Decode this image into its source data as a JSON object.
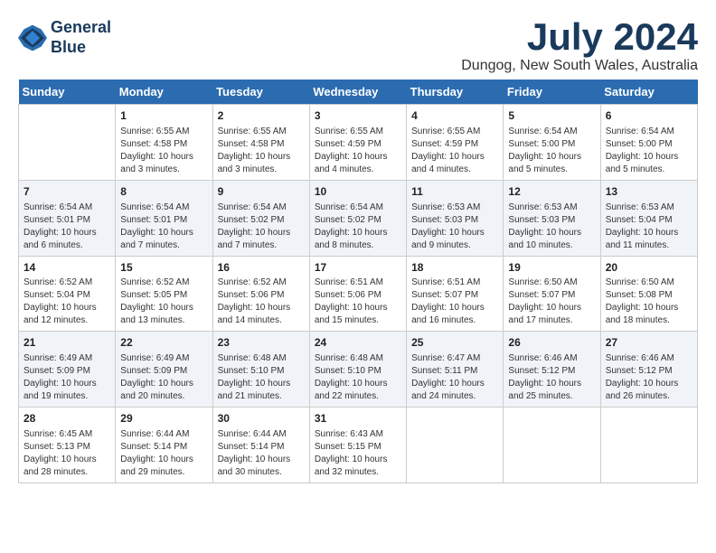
{
  "header": {
    "logo_line1": "General",
    "logo_line2": "Blue",
    "month": "July 2024",
    "location": "Dungog, New South Wales, Australia"
  },
  "days_of_week": [
    "Sunday",
    "Monday",
    "Tuesday",
    "Wednesday",
    "Thursday",
    "Friday",
    "Saturday"
  ],
  "weeks": [
    [
      {
        "day": "",
        "info": ""
      },
      {
        "day": "1",
        "info": "Sunrise: 6:55 AM\nSunset: 4:58 PM\nDaylight: 10 hours\nand 3 minutes."
      },
      {
        "day": "2",
        "info": "Sunrise: 6:55 AM\nSunset: 4:58 PM\nDaylight: 10 hours\nand 3 minutes."
      },
      {
        "day": "3",
        "info": "Sunrise: 6:55 AM\nSunset: 4:59 PM\nDaylight: 10 hours\nand 4 minutes."
      },
      {
        "day": "4",
        "info": "Sunrise: 6:55 AM\nSunset: 4:59 PM\nDaylight: 10 hours\nand 4 minutes."
      },
      {
        "day": "5",
        "info": "Sunrise: 6:54 AM\nSunset: 5:00 PM\nDaylight: 10 hours\nand 5 minutes."
      },
      {
        "day": "6",
        "info": "Sunrise: 6:54 AM\nSunset: 5:00 PM\nDaylight: 10 hours\nand 5 minutes."
      }
    ],
    [
      {
        "day": "7",
        "info": "Sunrise: 6:54 AM\nSunset: 5:01 PM\nDaylight: 10 hours\nand 6 minutes."
      },
      {
        "day": "8",
        "info": "Sunrise: 6:54 AM\nSunset: 5:01 PM\nDaylight: 10 hours\nand 7 minutes."
      },
      {
        "day": "9",
        "info": "Sunrise: 6:54 AM\nSunset: 5:02 PM\nDaylight: 10 hours\nand 7 minutes."
      },
      {
        "day": "10",
        "info": "Sunrise: 6:54 AM\nSunset: 5:02 PM\nDaylight: 10 hours\nand 8 minutes."
      },
      {
        "day": "11",
        "info": "Sunrise: 6:53 AM\nSunset: 5:03 PM\nDaylight: 10 hours\nand 9 minutes."
      },
      {
        "day": "12",
        "info": "Sunrise: 6:53 AM\nSunset: 5:03 PM\nDaylight: 10 hours\nand 10 minutes."
      },
      {
        "day": "13",
        "info": "Sunrise: 6:53 AM\nSunset: 5:04 PM\nDaylight: 10 hours\nand 11 minutes."
      }
    ],
    [
      {
        "day": "14",
        "info": "Sunrise: 6:52 AM\nSunset: 5:04 PM\nDaylight: 10 hours\nand 12 minutes."
      },
      {
        "day": "15",
        "info": "Sunrise: 6:52 AM\nSunset: 5:05 PM\nDaylight: 10 hours\nand 13 minutes."
      },
      {
        "day": "16",
        "info": "Sunrise: 6:52 AM\nSunset: 5:06 PM\nDaylight: 10 hours\nand 14 minutes."
      },
      {
        "day": "17",
        "info": "Sunrise: 6:51 AM\nSunset: 5:06 PM\nDaylight: 10 hours\nand 15 minutes."
      },
      {
        "day": "18",
        "info": "Sunrise: 6:51 AM\nSunset: 5:07 PM\nDaylight: 10 hours\nand 16 minutes."
      },
      {
        "day": "19",
        "info": "Sunrise: 6:50 AM\nSunset: 5:07 PM\nDaylight: 10 hours\nand 17 minutes."
      },
      {
        "day": "20",
        "info": "Sunrise: 6:50 AM\nSunset: 5:08 PM\nDaylight: 10 hours\nand 18 minutes."
      }
    ],
    [
      {
        "day": "21",
        "info": "Sunrise: 6:49 AM\nSunset: 5:09 PM\nDaylight: 10 hours\nand 19 minutes."
      },
      {
        "day": "22",
        "info": "Sunrise: 6:49 AM\nSunset: 5:09 PM\nDaylight: 10 hours\nand 20 minutes."
      },
      {
        "day": "23",
        "info": "Sunrise: 6:48 AM\nSunset: 5:10 PM\nDaylight: 10 hours\nand 21 minutes."
      },
      {
        "day": "24",
        "info": "Sunrise: 6:48 AM\nSunset: 5:10 PM\nDaylight: 10 hours\nand 22 minutes."
      },
      {
        "day": "25",
        "info": "Sunrise: 6:47 AM\nSunset: 5:11 PM\nDaylight: 10 hours\nand 24 minutes."
      },
      {
        "day": "26",
        "info": "Sunrise: 6:46 AM\nSunset: 5:12 PM\nDaylight: 10 hours\nand 25 minutes."
      },
      {
        "day": "27",
        "info": "Sunrise: 6:46 AM\nSunset: 5:12 PM\nDaylight: 10 hours\nand 26 minutes."
      }
    ],
    [
      {
        "day": "28",
        "info": "Sunrise: 6:45 AM\nSunset: 5:13 PM\nDaylight: 10 hours\nand 28 minutes."
      },
      {
        "day": "29",
        "info": "Sunrise: 6:44 AM\nSunset: 5:14 PM\nDaylight: 10 hours\nand 29 minutes."
      },
      {
        "day": "30",
        "info": "Sunrise: 6:44 AM\nSunset: 5:14 PM\nDaylight: 10 hours\nand 30 minutes."
      },
      {
        "day": "31",
        "info": "Sunrise: 6:43 AM\nSunset: 5:15 PM\nDaylight: 10 hours\nand 32 minutes."
      },
      {
        "day": "",
        "info": ""
      },
      {
        "day": "",
        "info": ""
      },
      {
        "day": "",
        "info": ""
      }
    ]
  ]
}
